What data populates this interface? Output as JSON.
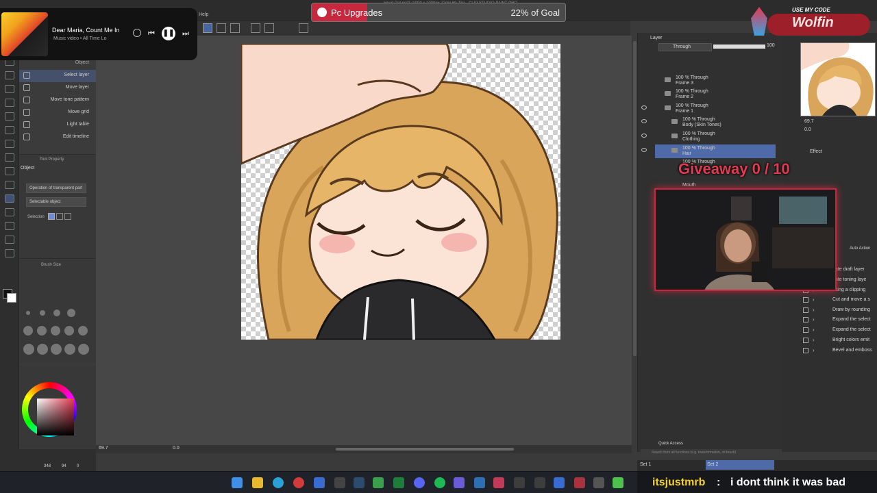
{
  "menu": {
    "help_label": "Help"
  },
  "music_player": {
    "title": "Dear Maria, Count Me In",
    "subtitle": "Music video • All Time Lo"
  },
  "goal_bar": {
    "label": "Pc Upgrades",
    "percent_text": "22% of Goal",
    "progress": 0.22,
    "fill_color": "#c8283e",
    "file_info": "Head Pat.psd* (1000 x 1000px 72dpi 69.7%) - CLIP STUDIO PAINT PRO"
  },
  "promo": {
    "header": "USE MY CODE",
    "code": "Wolfin"
  },
  "subtool": {
    "tab": "Object",
    "items": [
      {
        "label": "Select layer",
        "icon": "select-layer-icon"
      },
      {
        "label": "Move layer",
        "icon": "move-icon"
      },
      {
        "label": "Move tone pattern",
        "icon": "move-icon"
      },
      {
        "label": "Move grid",
        "icon": "move-icon"
      },
      {
        "label": "Light table",
        "icon": "light-table-icon"
      },
      {
        "label": "Edit timeline",
        "icon": "timeline-icon"
      }
    ]
  },
  "tool_property": {
    "title": "Tool Property",
    "heading": "Object",
    "dropdown1": "Operation of transparent part",
    "dropdown2": "Selectable object",
    "selection_label": "Selection"
  },
  "brush_size": {
    "title": "Brush Size"
  },
  "left_status": {
    "zoom": "348",
    "opacity": "94",
    "angle": "0"
  },
  "canvas_footer": {
    "zoom": "69.7",
    "rotate": "0.0"
  },
  "layers": {
    "title": "Layer",
    "blend_mode": "Through",
    "opacity": "100",
    "rows": [
      {
        "line1": "100 % Through",
        "line2": "Frame 3"
      },
      {
        "line1": "100 % Through",
        "line2": "Frame 2"
      },
      {
        "line1": "100 % Through",
        "line2": "Frame 1"
      },
      {
        "line1": "100 % Through",
        "line2": "Body (Skin Tones)"
      },
      {
        "line1": "100 % Through",
        "line2": "Clothing"
      },
      {
        "line1": "100 % Through",
        "line2": "Hair"
      },
      {
        "line1": "100 % Through",
        "line2": ""
      },
      {
        "line1": "",
        "line2": "Mouth"
      }
    ],
    "quick_access": "Quick Access",
    "search_placeholder": "Search from all functions (e.g. transformation, oil brush)"
  },
  "navigator": {
    "zoom": "69.7",
    "rotate": "0.0"
  },
  "effect_panel": {
    "title": "Effect"
  },
  "auto_action": {
    "title": "Auto Action",
    "items": [
      "eate draft layer",
      "eate toning laye",
      "aking a clipping",
      "Cut and move a s",
      "Draw by rounding",
      "Expand the select",
      "Expand the select",
      "Bright colors emit",
      "Bevel and emboss"
    ]
  },
  "status_bar": {
    "set1": "Set 1",
    "set2": "Set 2"
  },
  "giveaway": {
    "text": "Giveaway 0 / 10"
  },
  "chat": {
    "user": "itsjustmrb",
    "message": "i dont think it was bad"
  },
  "colors": {
    "accent_red": "#c2283f",
    "layer_selected": "#4f6aa8",
    "panel_bg": "#303030",
    "canvas_bg": "#474747"
  }
}
